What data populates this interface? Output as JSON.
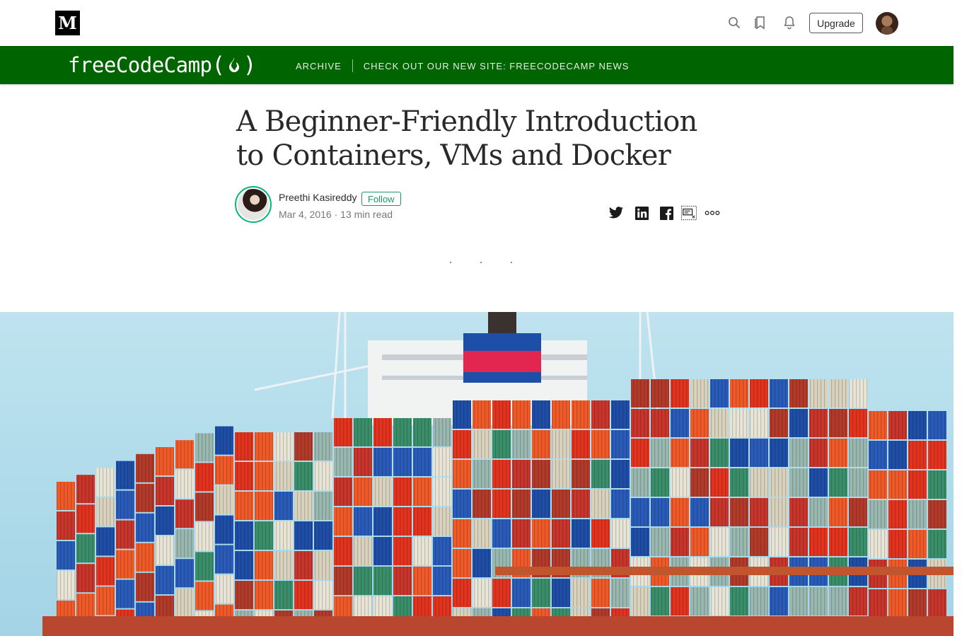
{
  "topbar": {
    "logo_letter": "M",
    "upgrade_label": "Upgrade",
    "icons": [
      "search-icon",
      "bookmark-icon",
      "bell-icon"
    ]
  },
  "publication": {
    "logo_text": "freeCodeCamp",
    "logo_open_paren": "(",
    "logo_close_paren": ")",
    "nav": {
      "archive": "ARCHIVE",
      "new_site": "CHECK OUT OUR NEW SITE: FREECODECAMP NEWS"
    },
    "color": "#006400"
  },
  "article": {
    "title": "A Beginner-Friendly Introduction to Containers, VMs and Docker",
    "author": "Preethi Kasireddy",
    "follow_label": "Follow",
    "meta": "Mar 4, 2016 · 13 min read",
    "section_divider": "· · ·",
    "share_icons": [
      "twitter-icon",
      "linkedin-icon",
      "facebook-icon",
      "highlight-icon",
      "more-icon"
    ],
    "hero_image": "cargo ship stacked with shipping containers"
  },
  "colors": {
    "accent_green": "#1c9963"
  }
}
